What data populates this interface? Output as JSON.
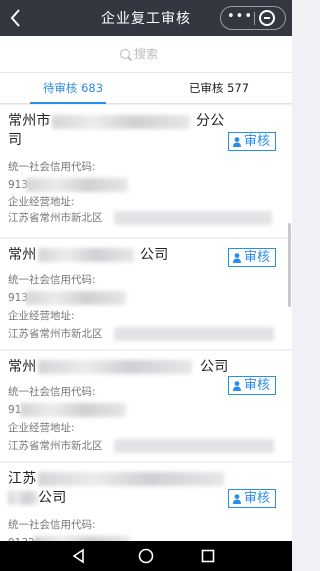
{
  "titlebar": {
    "title": "企业复工审核",
    "back_icon": "chevron-left-icon",
    "more_label": "•••",
    "close_icon": "circle-minus-icon"
  },
  "search": {
    "placeholder": "搜索"
  },
  "tabs": [
    {
      "label": "待审核 683",
      "active": true
    },
    {
      "label": "已审核 577",
      "active": false
    }
  ],
  "audit_label": "审核",
  "colors": {
    "accent": "#2a8ee8",
    "titlebar": "#34373f",
    "navbar": "#000000"
  },
  "cards": [
    {
      "name_start": "常州市",
      "name_end": "分公",
      "name_line2": "司",
      "credit_label": "统一社会信用代码:",
      "credit_value": "913",
      "address_label": "企业经营地址:",
      "address_value": "江苏省常州市新北区"
    },
    {
      "name_start": "常州",
      "name_end": "公司",
      "credit_label": "统一社会信用代码:",
      "credit_value": "913",
      "address_label": "企业经营地址:",
      "address_value": "江苏省常州市新北区"
    },
    {
      "name_start": "常州",
      "name_end": "公司",
      "credit_label": "统一社会信用代码:",
      "credit_value": "91",
      "address_label": "企业经营地址:",
      "address_value": "江苏省常州市新北区"
    },
    {
      "name_start": "江苏",
      "name_line2": "公司",
      "credit_label": "统一社会信用代码:",
      "credit_value": "91320"
    }
  ],
  "navbar": {
    "icons": [
      "back-triangle-icon",
      "home-circle-icon",
      "recents-square-icon"
    ]
  }
}
